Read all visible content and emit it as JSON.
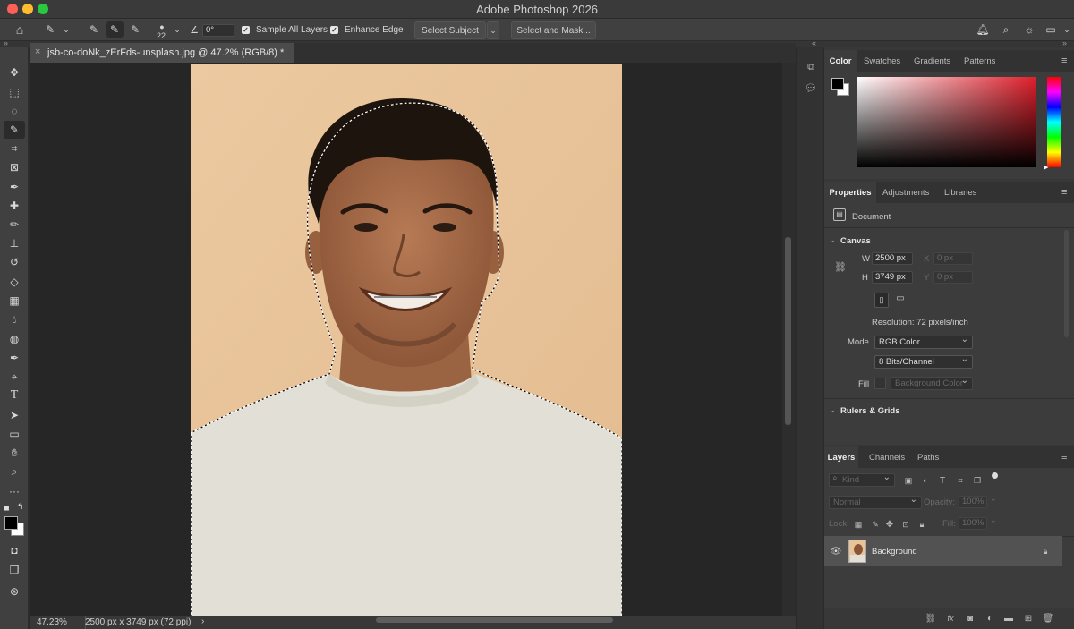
{
  "window": {
    "title": "Adobe Photoshop 2026"
  },
  "options_bar": {
    "brush_size": "22",
    "angle": "0°",
    "sample_all_layers": "Sample All Layers",
    "enhance_edge": "Enhance Edge",
    "select_subject": "Select Subject",
    "select_and_mask": "Select and Mask..."
  },
  "document": {
    "tab_title": "jsb-co-doNk_zErFds-unsplash.jpg @ 47.2% (RGB/8) *",
    "zoom": "47.23%",
    "dimensions_info": "2500 px x 3749 px (72 ppi)"
  },
  "color_panel": {
    "tabs": [
      "Color",
      "Swatches",
      "Gradients",
      "Patterns"
    ],
    "active": "Color"
  },
  "properties_panel": {
    "tabs": [
      "Properties",
      "Adjustments",
      "Libraries"
    ],
    "active": "Properties",
    "type_label": "Document",
    "canvas_header": "Canvas",
    "w_label": "W",
    "w_value": "2500 px",
    "h_label": "H",
    "h_value": "3749 px",
    "x_label": "X",
    "x_value": "0 px",
    "y_label": "Y",
    "y_value": "0 px",
    "resolution": "Resolution: 72 pixels/inch",
    "mode_label": "Mode",
    "mode_value": "RGB Color",
    "bits_value": "8 Bits/Channel",
    "fill_label": "Fill",
    "fill_value": "Background Color",
    "rulers_header": "Rulers & Grids"
  },
  "layers_panel": {
    "tabs": [
      "Layers",
      "Channels",
      "Paths"
    ],
    "active": "Layers",
    "kind_label": "Kind",
    "blend_mode": "Normal",
    "opacity_label": "Opacity:",
    "opacity_value": "100%",
    "lock_label": "Lock:",
    "fill_label": "Fill:",
    "fill_value": "100%",
    "layers": [
      {
        "name": "Background",
        "locked": true,
        "visible": true
      }
    ]
  },
  "colors": {
    "photo_bg": "#e8c49b",
    "shirt": "#e2e0d6",
    "panel_bg": "#383838"
  }
}
